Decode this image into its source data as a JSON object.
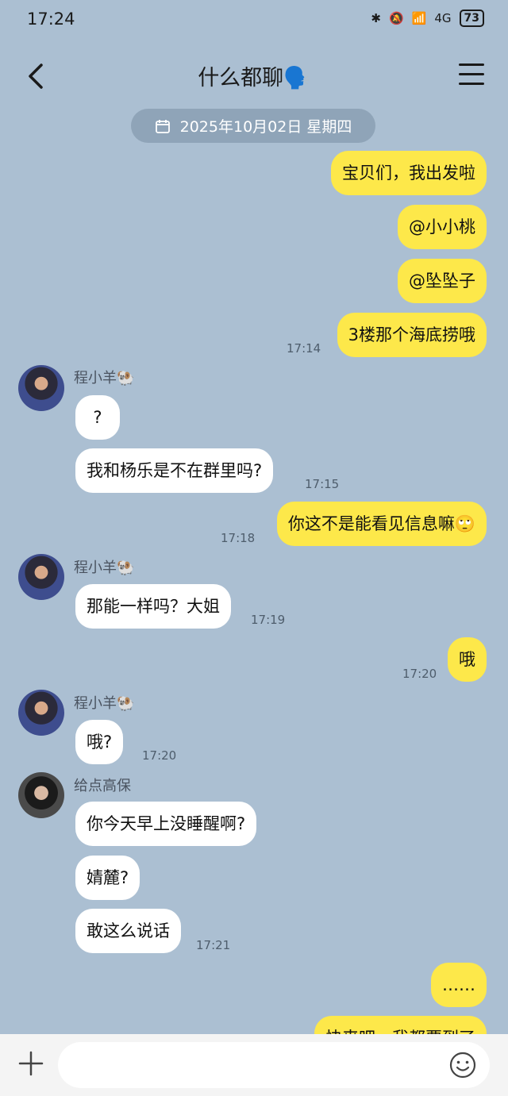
{
  "status_bar": {
    "time": "17:24",
    "network": "4G",
    "battery": "73"
  },
  "header": {
    "title": "什么都聊",
    "title_emoji": "🗣️"
  },
  "date_divider": "2025年10月02日 星期四",
  "messages": [
    {
      "dir": "out",
      "text": "宝贝们，我出发啦"
    },
    {
      "dir": "out",
      "text": "@小小桃"
    },
    {
      "dir": "out",
      "text": "@坠坠子"
    },
    {
      "dir": "out",
      "text": "3楼那个海底捞哦",
      "time": "17:14"
    },
    {
      "dir": "in",
      "sender": "程小羊🐏",
      "text": "?"
    },
    {
      "dir": "in",
      "text": "我和杨乐是不在群里吗?",
      "time": "17:15"
    },
    {
      "dir": "out",
      "text": "你这不是能看见信息嘛🙄",
      "time": "17:18"
    },
    {
      "dir": "in",
      "sender": "程小羊🐏",
      "text": "那能一样吗？大姐",
      "time": "17:19"
    },
    {
      "dir": "out",
      "text": "哦",
      "time": "17:20"
    },
    {
      "dir": "in",
      "sender": "程小羊🐏",
      "text": "哦?",
      "time": "17:20"
    },
    {
      "dir": "in",
      "sender": "给点高保",
      "text": "你今天早上没睡醒啊?"
    },
    {
      "dir": "in",
      "text": "婧麓?"
    },
    {
      "dir": "in",
      "text": "敢这么说话",
      "time": "17:21"
    },
    {
      "dir": "out",
      "text": "……"
    },
    {
      "dir": "out",
      "text": "快来吧，我都要到了"
    }
  ],
  "composer": {
    "placeholder": ""
  },
  "icons": {
    "back": "chevron-left-icon",
    "menu": "hamburger-menu-icon",
    "calendar": "calendar-icon",
    "plus": "plus-icon",
    "emoji": "smile-icon"
  },
  "colors": {
    "background": "#abbfd2",
    "outgoing": "#fde84a",
    "incoming": "#ffffff"
  }
}
